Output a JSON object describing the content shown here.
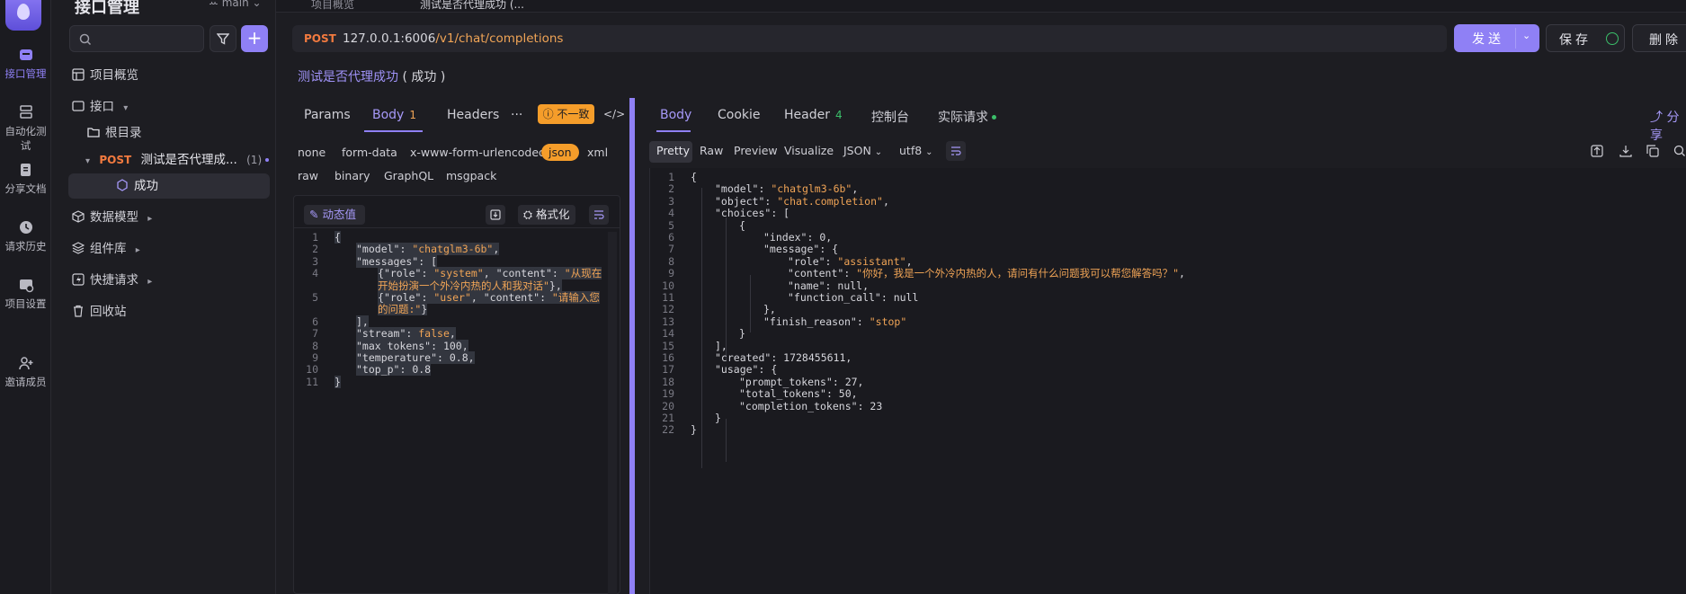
{
  "rail": {
    "items": [
      {
        "label": "接口管理",
        "icon": "api-icon"
      },
      {
        "label": "自动化测试",
        "icon": "test-icon"
      },
      {
        "label": "分享文档",
        "icon": "doc-icon"
      },
      {
        "label": "请求历史",
        "icon": "history-icon"
      },
      {
        "label": "项目设置",
        "icon": "settings-icon"
      },
      {
        "label": "邀请成员",
        "icon": "invite-icon"
      }
    ]
  },
  "sidebar": {
    "title": "接口管理",
    "branch": "ꕀ main ⌄",
    "tree": [
      {
        "label": "项目概览"
      },
      {
        "label": "接口",
        "caret": "▾"
      },
      {
        "label": "根目录"
      },
      {
        "method": "POST",
        "label": "测试是否代理成...",
        "count": "(1)"
      },
      {
        "label": "成功"
      },
      {
        "label": "数据模型",
        "caret": "▸"
      },
      {
        "label": "组件库",
        "caret": "▸"
      },
      {
        "label": "快捷请求",
        "caret": "▸"
      },
      {
        "label": "回收站"
      }
    ]
  },
  "tabs": {
    "t1": "项目概览",
    "t2": "测试是否代理成功 (..."
  },
  "request": {
    "method": "POST",
    "host": "127.0.0.1:6006",
    "path": "/v1/chat/completions",
    "send_label": "发送",
    "save_label": "保存",
    "delete_label": "删除",
    "name": "测试是否代理成功",
    "status": "( 成功 )",
    "tabs": {
      "params": "Params",
      "body": "Body",
      "body_badge": "1",
      "headers": "Headers",
      "more": "···"
    },
    "warning": "不一致",
    "body_types": [
      "none",
      "form-data",
      "x-www-form-urlencoded",
      "json",
      "xml",
      "raw",
      "binary",
      "GraphQL",
      "msgpack"
    ],
    "dynamic_label": "动态值",
    "format_label": "格式化",
    "code": [
      {
        "ln": "1",
        "parts": [
          {
            "t": "{",
            "c": "k"
          }
        ]
      },
      {
        "ln": "2",
        "parts": [
          {
            "t": "\"model\"",
            "c": "k"
          },
          {
            "t": ": ",
            "c": "k"
          },
          {
            "t": "\"chatglm3-6b\"",
            "c": "s"
          },
          {
            "t": ",",
            "c": "k"
          }
        ]
      },
      {
        "ln": "3",
        "parts": [
          {
            "t": "\"messages\"",
            "c": "k"
          },
          {
            "t": ": [",
            "c": "k"
          }
        ]
      },
      {
        "ln": "4",
        "parts": [
          {
            "t": "{",
            "c": "k"
          },
          {
            "t": "\"role\"",
            "c": "k"
          },
          {
            "t": ": ",
            "c": "k"
          },
          {
            "t": "\"system\"",
            "c": "s"
          },
          {
            "t": ", ",
            "c": "k"
          },
          {
            "t": "\"content\"",
            "c": "k"
          },
          {
            "t": ": ",
            "c": "k"
          },
          {
            "t": "\"从现在",
            "c": "s"
          }
        ]
      },
      {
        "ln": "",
        "parts": [
          {
            "t": "开始扮演一个外冷内热的人和我对话\"",
            "c": "s"
          },
          {
            "t": "},",
            "c": "k"
          }
        ]
      },
      {
        "ln": "5",
        "parts": [
          {
            "t": "{",
            "c": "k"
          },
          {
            "t": "\"role\"",
            "c": "k"
          },
          {
            "t": ": ",
            "c": "k"
          },
          {
            "t": "\"user\"",
            "c": "s"
          },
          {
            "t": ", ",
            "c": "k"
          },
          {
            "t": "\"content\"",
            "c": "k"
          },
          {
            "t": ": ",
            "c": "k"
          },
          {
            "t": "\"请输入您",
            "c": "s"
          }
        ]
      },
      {
        "ln": "",
        "parts": [
          {
            "t": "的问题:\"",
            "c": "s"
          },
          {
            "t": "}",
            "c": "k"
          }
        ]
      },
      {
        "ln": "6",
        "parts": [
          {
            "t": "],",
            "c": "k"
          }
        ]
      },
      {
        "ln": "7",
        "parts": [
          {
            "t": "\"stream\"",
            "c": "k"
          },
          {
            "t": ": ",
            "c": "k"
          },
          {
            "t": "false",
            "c": "s"
          },
          {
            "t": ",",
            "c": "k"
          }
        ]
      },
      {
        "ln": "8",
        "parts": [
          {
            "t": "\"max_tokens\"",
            "c": "k"
          },
          {
            "t": ": 100,",
            "c": "n"
          }
        ]
      },
      {
        "ln": "9",
        "parts": [
          {
            "t": "\"temperature\"",
            "c": "k"
          },
          {
            "t": ": 0.8,",
            "c": "n"
          }
        ]
      },
      {
        "ln": "10",
        "parts": [
          {
            "t": "\"top_p\"",
            "c": "k"
          },
          {
            "t": ": 0.8",
            "c": "n"
          }
        ]
      },
      {
        "ln": "11",
        "parts": [
          {
            "t": "}",
            "c": "k"
          }
        ]
      }
    ]
  },
  "response": {
    "tabs": {
      "body": "Body",
      "cookie": "Cookie",
      "header": "Header",
      "header_badge": "4",
      "console": "控制台",
      "actual": "实际请求"
    },
    "share_label": "分享",
    "formats": [
      "Pretty",
      "Raw",
      "Preview",
      "Visualize"
    ],
    "json_select": "JSON",
    "encoding_select": "utf8",
    "code": [
      {
        "ln": "1",
        "parts": [
          {
            "t": "{",
            "c": "k"
          }
        ]
      },
      {
        "ln": "2",
        "parts": [
          {
            "t": "\"model\"",
            "c": "k"
          },
          {
            "t": ": ",
            "c": "k"
          },
          {
            "t": "\"chatglm3-6b\"",
            "c": "s"
          },
          {
            "t": ",",
            "c": "k"
          }
        ]
      },
      {
        "ln": "3",
        "parts": [
          {
            "t": "\"object\"",
            "c": "k"
          },
          {
            "t": ": ",
            "c": "k"
          },
          {
            "t": "\"chat.completion\"",
            "c": "s"
          },
          {
            "t": ",",
            "c": "k"
          }
        ]
      },
      {
        "ln": "4",
        "parts": [
          {
            "t": "\"choices\"",
            "c": "k"
          },
          {
            "t": ": [",
            "c": "k"
          }
        ]
      },
      {
        "ln": "5",
        "parts": [
          {
            "t": "{",
            "c": "k"
          }
        ]
      },
      {
        "ln": "6",
        "parts": [
          {
            "t": "\"index\"",
            "c": "k"
          },
          {
            "t": ": 0,",
            "c": "n"
          }
        ]
      },
      {
        "ln": "7",
        "parts": [
          {
            "t": "\"message\"",
            "c": "k"
          },
          {
            "t": ": {",
            "c": "k"
          }
        ]
      },
      {
        "ln": "8",
        "parts": [
          {
            "t": "\"role\"",
            "c": "k"
          },
          {
            "t": ": ",
            "c": "k"
          },
          {
            "t": "\"assistant\"",
            "c": "s"
          },
          {
            "t": ",",
            "c": "k"
          }
        ]
      },
      {
        "ln": "9",
        "parts": [
          {
            "t": "\"content\"",
            "c": "k"
          },
          {
            "t": ": ",
            "c": "k"
          },
          {
            "t": "\"你好，我是一个外冷内热的人，请问有什么问题我可以帮您解答吗？\"",
            "c": "s"
          },
          {
            "t": ",",
            "c": "k"
          }
        ]
      },
      {
        "ln": "10",
        "parts": [
          {
            "t": "\"name\"",
            "c": "k"
          },
          {
            "t": ": null,",
            "c": "n"
          }
        ]
      },
      {
        "ln": "11",
        "parts": [
          {
            "t": "\"function_call\"",
            "c": "k"
          },
          {
            "t": ": null",
            "c": "n"
          }
        ]
      },
      {
        "ln": "12",
        "parts": [
          {
            "t": "},",
            "c": "k"
          }
        ]
      },
      {
        "ln": "13",
        "parts": [
          {
            "t": "\"finish_reason\"",
            "c": "k"
          },
          {
            "t": ": ",
            "c": "k"
          },
          {
            "t": "\"stop\"",
            "c": "s"
          }
        ]
      },
      {
        "ln": "14",
        "parts": [
          {
            "t": "}",
            "c": "k"
          }
        ]
      },
      {
        "ln": "15",
        "parts": [
          {
            "t": "],",
            "c": "k"
          }
        ]
      },
      {
        "ln": "16",
        "parts": [
          {
            "t": "\"created\"",
            "c": "k"
          },
          {
            "t": ": 1728455611,",
            "c": "n"
          }
        ]
      },
      {
        "ln": "17",
        "parts": [
          {
            "t": "\"usage\"",
            "c": "k"
          },
          {
            "t": ": {",
            "c": "k"
          }
        ]
      },
      {
        "ln": "18",
        "parts": [
          {
            "t": "\"prompt_tokens\"",
            "c": "k"
          },
          {
            "t": ": 27,",
            "c": "n"
          }
        ]
      },
      {
        "ln": "19",
        "parts": [
          {
            "t": "\"total_tokens\"",
            "c": "k"
          },
          {
            "t": ": 50,",
            "c": "n"
          }
        ]
      },
      {
        "ln": "20",
        "parts": [
          {
            "t": "\"completion_tokens\"",
            "c": "k"
          },
          {
            "t": ": 23",
            "c": "n"
          }
        ]
      },
      {
        "ln": "21",
        "parts": [
          {
            "t": "}",
            "c": "k"
          }
        ]
      },
      {
        "ln": "22",
        "parts": [
          {
            "t": "}",
            "c": "k"
          }
        ]
      }
    ]
  },
  "colors": {
    "accent": "#8f80f5",
    "warning": "#f59d2a",
    "post": "#f27a3f",
    "string": "#f0a456",
    "success": "#3bbf6a"
  }
}
